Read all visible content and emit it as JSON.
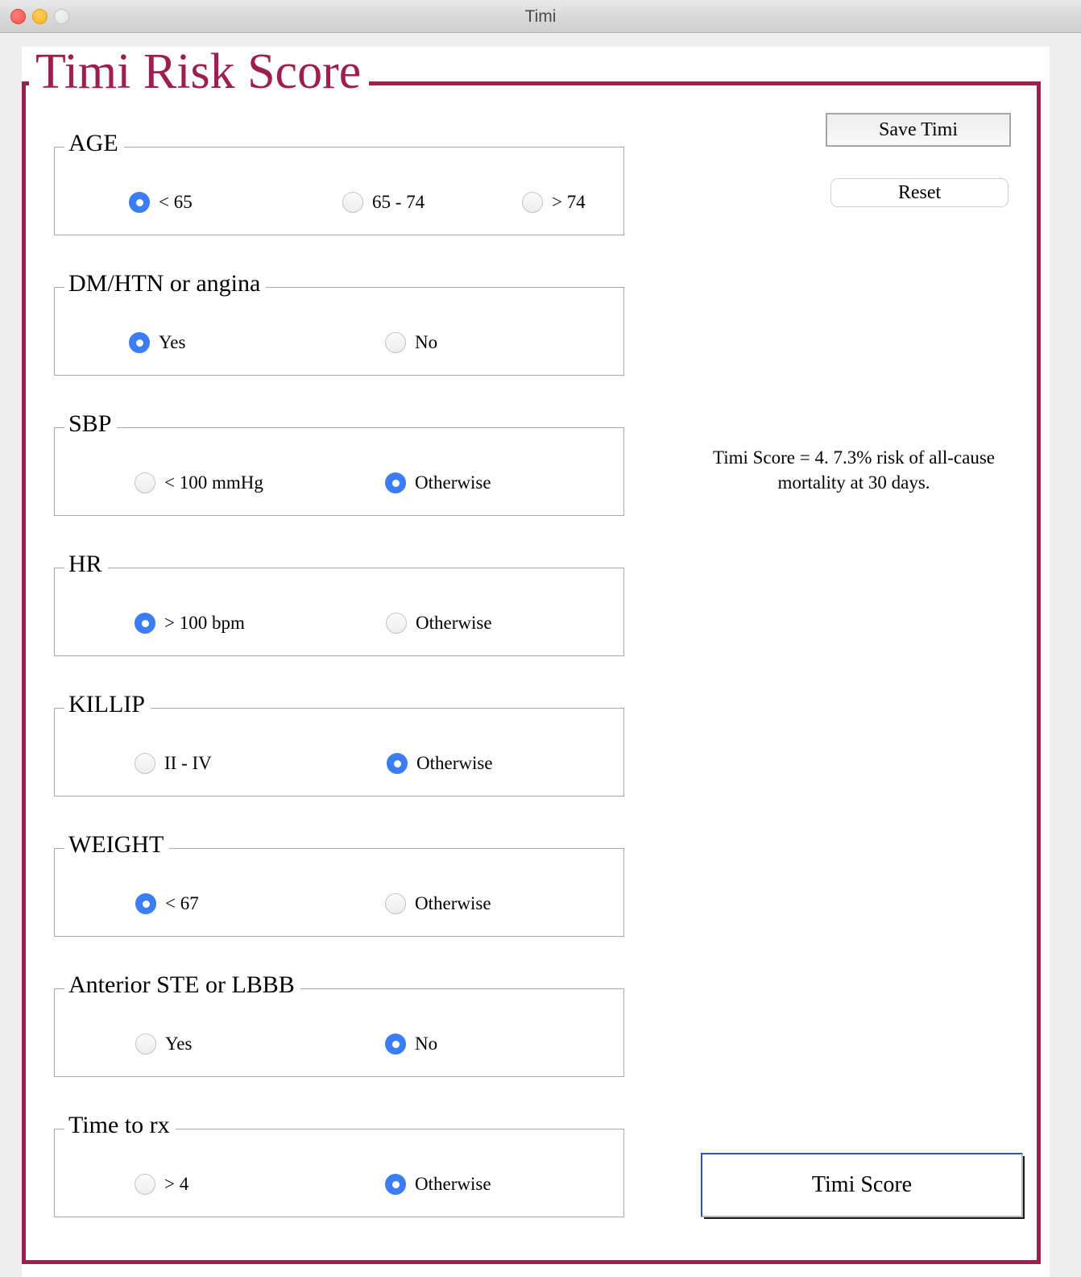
{
  "window": {
    "title": "Timi",
    "traffic_lights": [
      {
        "name": "close-button",
        "color": "#f4534a"
      },
      {
        "name": "minimize-button",
        "color": "#f9b021"
      },
      {
        "name": "maximize-button",
        "color": "#e2e2e2"
      }
    ]
  },
  "panel": {
    "title": "Timi Risk Score",
    "accent_color": "#9c1f4e"
  },
  "groups": [
    {
      "title": "AGE",
      "options": [
        {
          "label": "< 65",
          "selected": true
        },
        {
          "label": "65 - 74",
          "selected": false
        },
        {
          "label": "> 74",
          "selected": false
        }
      ]
    },
    {
      "title": "DM/HTN or angina",
      "options": [
        {
          "label": "Yes",
          "selected": true
        },
        {
          "label": "No",
          "selected": false
        }
      ]
    },
    {
      "title": "SBP",
      "options": [
        {
          "label": "< 100 mmHg",
          "selected": false
        },
        {
          "label": "Otherwise",
          "selected": true
        }
      ]
    },
    {
      "title": "HR",
      "options": [
        {
          "label": "> 100 bpm",
          "selected": true
        },
        {
          "label": "Otherwise",
          "selected": false
        }
      ]
    },
    {
      "title": "KILLIP",
      "options": [
        {
          "label": "II - IV",
          "selected": false
        },
        {
          "label": "Otherwise",
          "selected": true
        }
      ]
    },
    {
      "title": "WEIGHT",
      "options": [
        {
          "label": "< 67",
          "selected": true
        },
        {
          "label": "Otherwise",
          "selected": false
        }
      ]
    },
    {
      "title": "Anterior STE or LBBB",
      "options": [
        {
          "label": "Yes",
          "selected": false
        },
        {
          "label": "No",
          "selected": true
        }
      ]
    },
    {
      "title": "Time to rx",
      "options": [
        {
          "label": "> 4",
          "selected": false
        },
        {
          "label": "Otherwise",
          "selected": true
        }
      ]
    }
  ],
  "actions": {
    "save_label": "Save Timi",
    "reset_label": "Reset",
    "compute_label": "Timi Score"
  },
  "result": {
    "text": "Timi Score = 4. 7.3% risk of all-cause mortality at 30 days.",
    "score": 4,
    "risk_percent": "7.3%",
    "horizon": "30 days"
  }
}
